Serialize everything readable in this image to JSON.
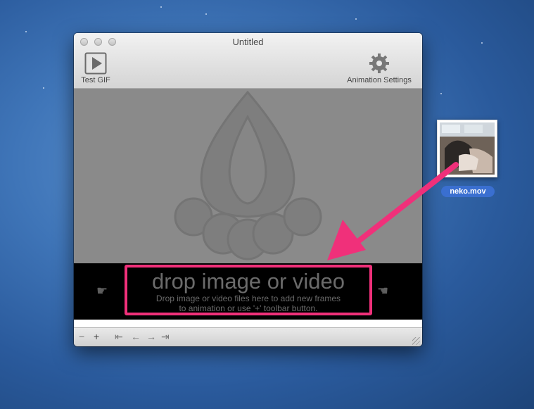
{
  "window": {
    "title": "Untitled",
    "toolbar": {
      "test_gif_label": "Test GIF",
      "animation_settings_label": "Animation Settings"
    }
  },
  "dropzone": {
    "headline": "drop image or video",
    "instructions_line1": "Drop image or video files here to add new frames",
    "instructions_line2": "to animation or use '+' toolbar button."
  },
  "bottombar": {
    "remove_glyph": "−",
    "add_glyph": "+",
    "first_glyph": "⇤",
    "prev_glyph": "←",
    "next_glyph": "→",
    "last_glyph": "⇥"
  },
  "desktop": {
    "file_name": "neko.mov"
  },
  "colors": {
    "highlight": "#f0307a",
    "canvas": "#8a8a8a",
    "dropzone": "#000000",
    "selection": "#3a6fd0"
  },
  "icons": [
    "play-icon",
    "gear-icon",
    "flame-logo-watermark",
    "hand-pointing-right-icon",
    "hand-pointing-left-icon"
  ]
}
